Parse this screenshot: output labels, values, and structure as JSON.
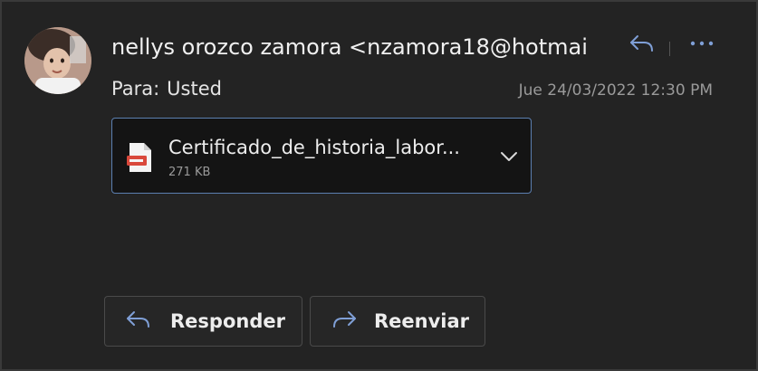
{
  "message": {
    "sender": "nellys orozco zamora <nzamora18@hotmai",
    "to_label": "Para:",
    "to_value": "Usted",
    "date": "Jue 24/03/2022 12:30 PM"
  },
  "attachment": {
    "name": "Certificado_de_historia_labor...",
    "size": "271 KB",
    "icon": "pdf-file-icon"
  },
  "actions": {
    "reply_label": "Responder",
    "forward_label": "Reenviar"
  },
  "colors": {
    "background": "#232323",
    "accent_border": "#5b7fb0",
    "icon_blue": "#7f9fd6"
  }
}
